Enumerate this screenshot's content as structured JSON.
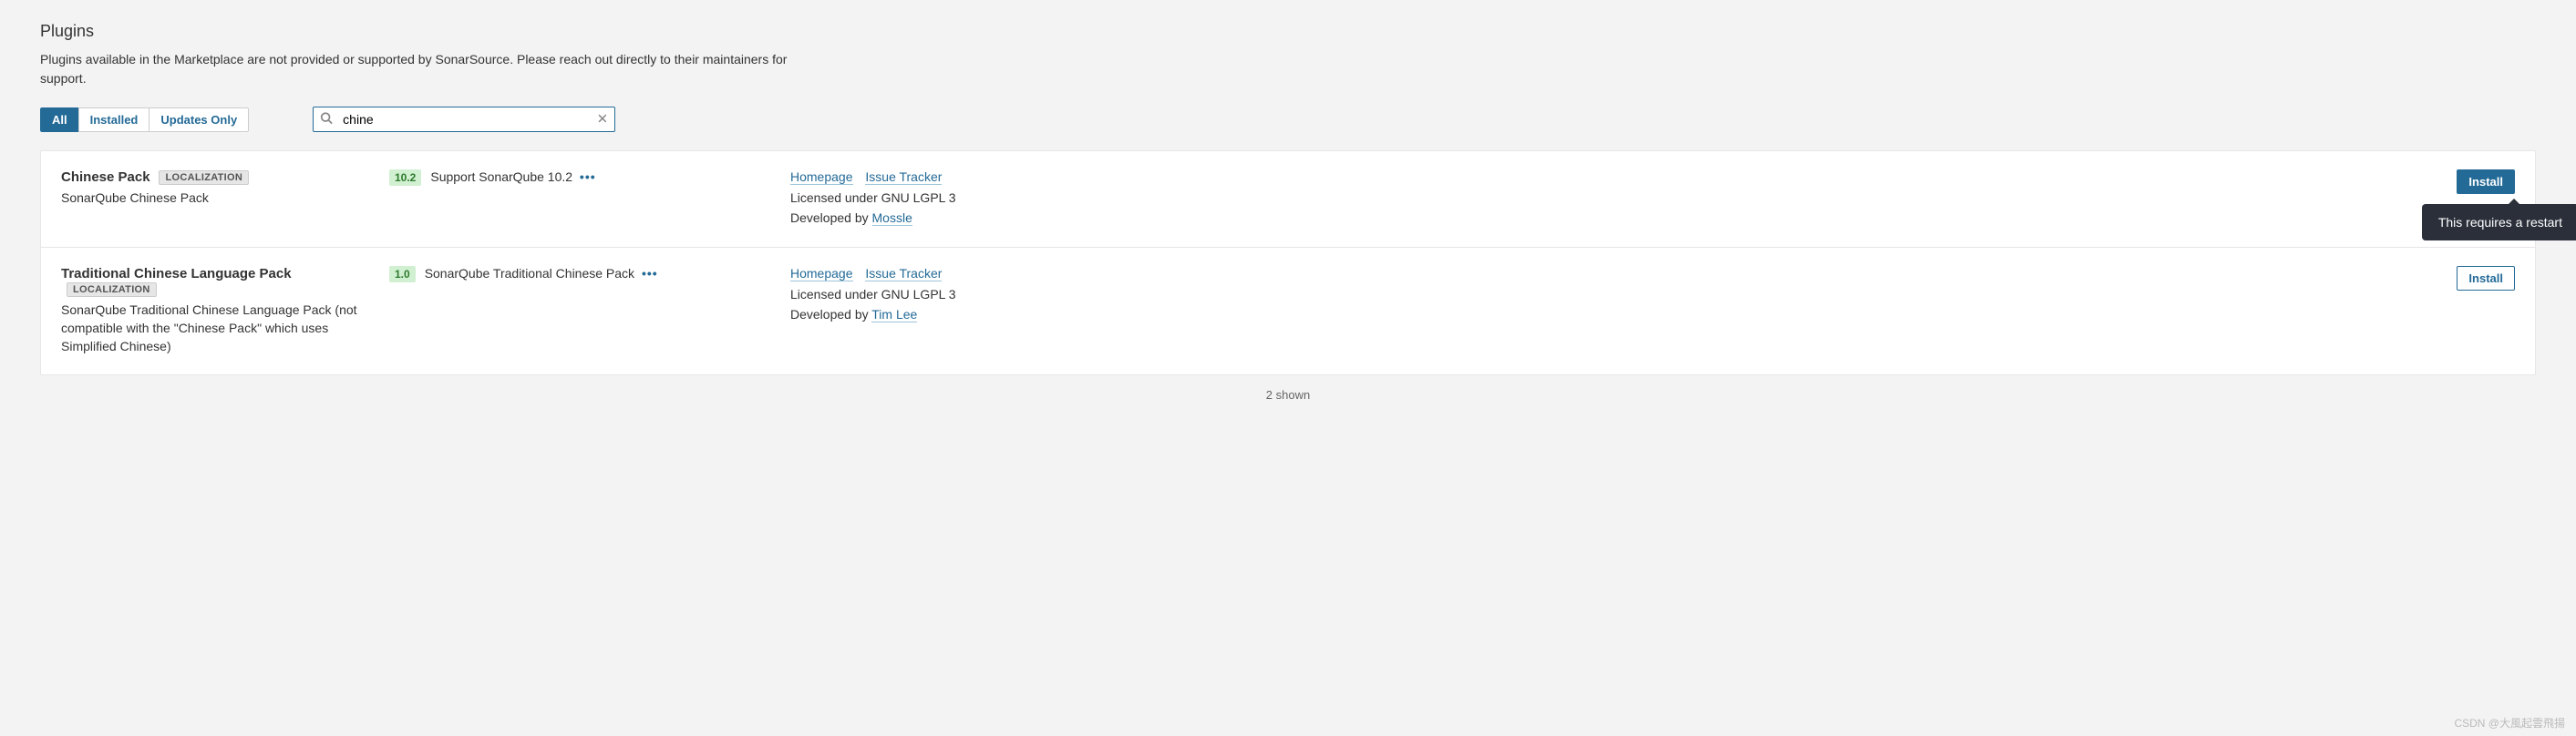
{
  "header": {
    "title": "Plugins",
    "description": "Plugins available in the Marketplace are not provided or supported by SonarSource. Please reach out directly to their maintainers for support."
  },
  "filters": {
    "all": "All",
    "installed": "Installed",
    "updates_only": "Updates Only"
  },
  "search": {
    "value": "chine"
  },
  "plugins": [
    {
      "name": "Chinese Pack",
      "category": "LOCALIZATION",
      "subtitle": "SonarQube Chinese Pack",
      "version": "10.2",
      "description": "Support SonarQube 10.2",
      "homepage": "Homepage",
      "issue_tracker": "Issue Tracker",
      "license_prefix": "Licensed under ",
      "license": "GNU LGPL 3",
      "developed_prefix": "Developed by ",
      "developer": "Mossle",
      "install_label": "Install",
      "primary": true,
      "tooltip": "This requires a restart"
    },
    {
      "name": "Traditional Chinese Language Pack",
      "category": "LOCALIZATION",
      "subtitle": "SonarQube Traditional Chinese Language Pack (not compatible with the \"Chinese Pack\" which uses Simplified Chinese)",
      "version": "1.0",
      "description": "SonarQube Traditional Chinese Pack",
      "homepage": "Homepage",
      "issue_tracker": "Issue Tracker",
      "license_prefix": "Licensed under ",
      "license": "GNU LGPL 3",
      "developed_prefix": "Developed by ",
      "developer": "Tim Lee",
      "install_label": "Install",
      "primary": false,
      "tooltip": null
    }
  ],
  "footer": {
    "shown": "2 shown"
  },
  "watermark": "CSDN @大風起雲飛揚"
}
